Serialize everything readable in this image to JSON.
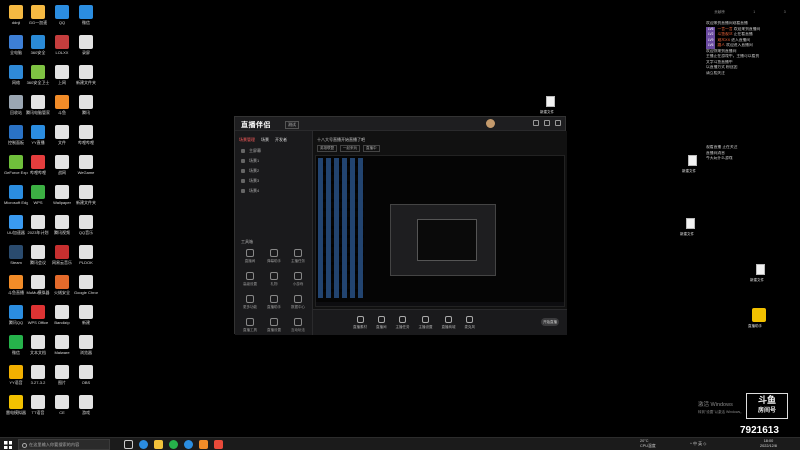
{
  "desktop": {
    "col1": [
      {
        "label": "ddnji",
        "color": "#f5b942"
      },
      {
        "label": "全电脑",
        "color": "#3d7fd6"
      },
      {
        "label": "网络",
        "color": "#2f8ad8"
      },
      {
        "label": "回收站",
        "color": "#9aa6b2"
      },
      {
        "label": "控制面板",
        "color": "#2a72c4"
      },
      {
        "label": "GeForce Experience",
        "color": "#6fbf3b"
      },
      {
        "label": "Microsoft Edge",
        "color": "#2b8de0"
      },
      {
        "label": "UU加速器",
        "color": "#3a9af0"
      },
      {
        "label": "Steam",
        "color": "#2a4b6e"
      },
      {
        "label": "斗鱼直播",
        "color": "#f28c28"
      },
      {
        "label": "腾讯QQ",
        "color": "#2b8de0"
      },
      {
        "label": "微信",
        "color": "#26b24b"
      },
      {
        "label": "YY语音",
        "color": "#f2b000"
      },
      {
        "label": "雷电模拟器",
        "color": "#f2c100"
      }
    ],
    "col2": [
      {
        "label": "GG一加速",
        "color": "#f5b942"
      },
      {
        "label": "360安全",
        "color": "#2a8ad6"
      },
      {
        "label": "360安全卫士",
        "color": "#7ec242"
      },
      {
        "label": "腾讯电脑管家",
        "color": "#e2e2e2"
      },
      {
        "label": "YY直播",
        "color": "#2b8de0"
      },
      {
        "label": "哔哩哔哩",
        "color": "#e43d3d"
      },
      {
        "label": "WPS",
        "color": "#3cb043"
      },
      {
        "label": "2023年计划",
        "color": "#e2e2e2"
      },
      {
        "label": "腾讯会议",
        "color": "#e2e2e2"
      },
      {
        "label": "MuMu模拟器",
        "color": "#e2e2e2"
      },
      {
        "label": "WPS Office",
        "color": "#d33"
      },
      {
        "label": "文本文档",
        "color": "#e2e2e2"
      },
      {
        "label": "3.27-3.2",
        "color": "#e2e2e2"
      },
      {
        "label": "TT语音",
        "color": "#e2e2e2"
      }
    ],
    "col3": [
      {
        "label": "QQ",
        "color": "#2b8de0"
      },
      {
        "label": "LOLXX",
        "color": "#c43d3d"
      },
      {
        "label": "上网",
        "color": "#e2e2e2"
      },
      {
        "label": "斗鱼",
        "color": "#f28c28"
      },
      {
        "label": "文件",
        "color": "#e2e2e2"
      },
      {
        "label": "战网",
        "color": "#e2e2e2"
      },
      {
        "label": "Wallpaper",
        "color": "#e2e2e2"
      },
      {
        "label": "腾讯视频",
        "color": "#e2e2e2"
      },
      {
        "label": "网易云音乐",
        "color": "#c62f2f"
      },
      {
        "label": "火绒安全",
        "color": "#e36a2b"
      },
      {
        "label": "Bandizip",
        "color": "#e2e2e2"
      },
      {
        "label": "Malware",
        "color": "#e2e2e2"
      },
      {
        "label": "图片",
        "color": "#e2e2e2"
      },
      {
        "label": "CE",
        "color": "#e2e2e2"
      }
    ],
    "col4": [
      {
        "label": "微信",
        "color": "#2b8de0"
      },
      {
        "label": "录屏",
        "color": "#e2e2e2"
      },
      {
        "label": "新建文件夹",
        "color": "#e2e2e2"
      },
      {
        "label": "腾讯",
        "color": "#e2e2e2"
      },
      {
        "label": "哔哩哔哩",
        "color": "#e2e2e2"
      },
      {
        "label": "WeGame",
        "color": "#e2e2e2"
      },
      {
        "label": "新建文件夹",
        "color": "#e2e2e2"
      },
      {
        "label": "QQ音乐",
        "color": "#e2e2e2"
      },
      {
        "label": "PLDOK",
        "color": "#e2e2e2"
      },
      {
        "label": "Google Chrome",
        "color": "#e2e2e2"
      },
      {
        "label": "新建",
        "color": "#e2e2e2"
      },
      {
        "label": "浏览器",
        "color": "#e2e2e2"
      },
      {
        "label": "OBS",
        "color": "#e2e2e2"
      },
      {
        "label": "游戏",
        "color": "#e2e2e2"
      }
    ]
  },
  "app": {
    "logo": "直播伴侣",
    "badge": "测试",
    "sidebar_tabs": [
      "场景管理",
      "场景",
      "开发者"
    ],
    "scenes": [
      "主屏幕",
      "场景1",
      "场景2",
      "场景3",
      "场景4"
    ],
    "tools_title": "工具箱",
    "tools": [
      "直播间",
      "弹幕助手",
      "主播任务",
      "高级设置",
      "礼物",
      "小游戏",
      "更多功能",
      "直播助手",
      "数据中心",
      "直播工具",
      "直播设置",
      "互动玩法"
    ],
    "stream_title": "十八大号直播开始直播了吧",
    "stream_tags": [
      "英雄联盟",
      "一起来玩",
      "直播中"
    ],
    "bottom_buttons": [
      "直播素材",
      "直播间",
      "主播任务",
      "主播设置",
      "直播商城",
      "麦克风"
    ],
    "start_live": "开始直播"
  },
  "chat": {
    "stats": [
      "贡献榜",
      "1",
      "3"
    ],
    "lines": [
      {
        "text": "欢迎来到直播间观看直播",
        "tag": "",
        "hi": ""
      },
      {
        "text": "欢迎来到直播间",
        "tag": "LV6",
        "hi": "一言一言"
      },
      {
        "text": "正在看直播",
        "tag": "LV2",
        "hi": "斗鱼观众"
      },
      {
        "text": "进入直播间",
        "tag": "LV9",
        "hi": "观众XX"
      },
      {
        "text": "欢迎进入直播间",
        "tag": "LV6",
        "hi": "路人"
      },
      {
        "text": "",
        "tag": "",
        "hi": ""
      },
      {
        "text": "欢迎你来到直播间",
        "tag": "",
        "hi": ""
      },
      {
        "text": "主播正在游戏中，主播可以看到",
        "tag": "",
        "hi": ""
      },
      {
        "text": "文字斗鱼直播中",
        "tag": "",
        "hi": ""
      },
      {
        "text": "以直播方式 粉丝团",
        "tag": "",
        "hi": ""
      },
      {
        "text": "请互相关注",
        "tag": "",
        "hi": ""
      }
    ],
    "lines2": [
      "观看直播 正在关注",
      "直播间消息",
      "今天玩什么游戏"
    ]
  },
  "floating_files": [
    {
      "label": "新建文件"
    },
    {
      "label": "新建文件"
    },
    {
      "label": "新建文件"
    },
    {
      "label": "新建文件"
    },
    {
      "label": "直播助手"
    }
  ],
  "watermark": {
    "activate_line1": "激活 Windows",
    "activate_line2": "转到\"设置\"以激活 Windows。",
    "logo": "斗鱼",
    "logo_sub": "房间号",
    "room_id": "7921613"
  },
  "taskbar": {
    "search_placeholder": "在这里输入你要搜索的内容",
    "weather_temp": "20°C",
    "weather_desc": "CPU温度",
    "tray": "^ 中 英 ◇",
    "time": "18:00",
    "date": "2022/12/8"
  }
}
